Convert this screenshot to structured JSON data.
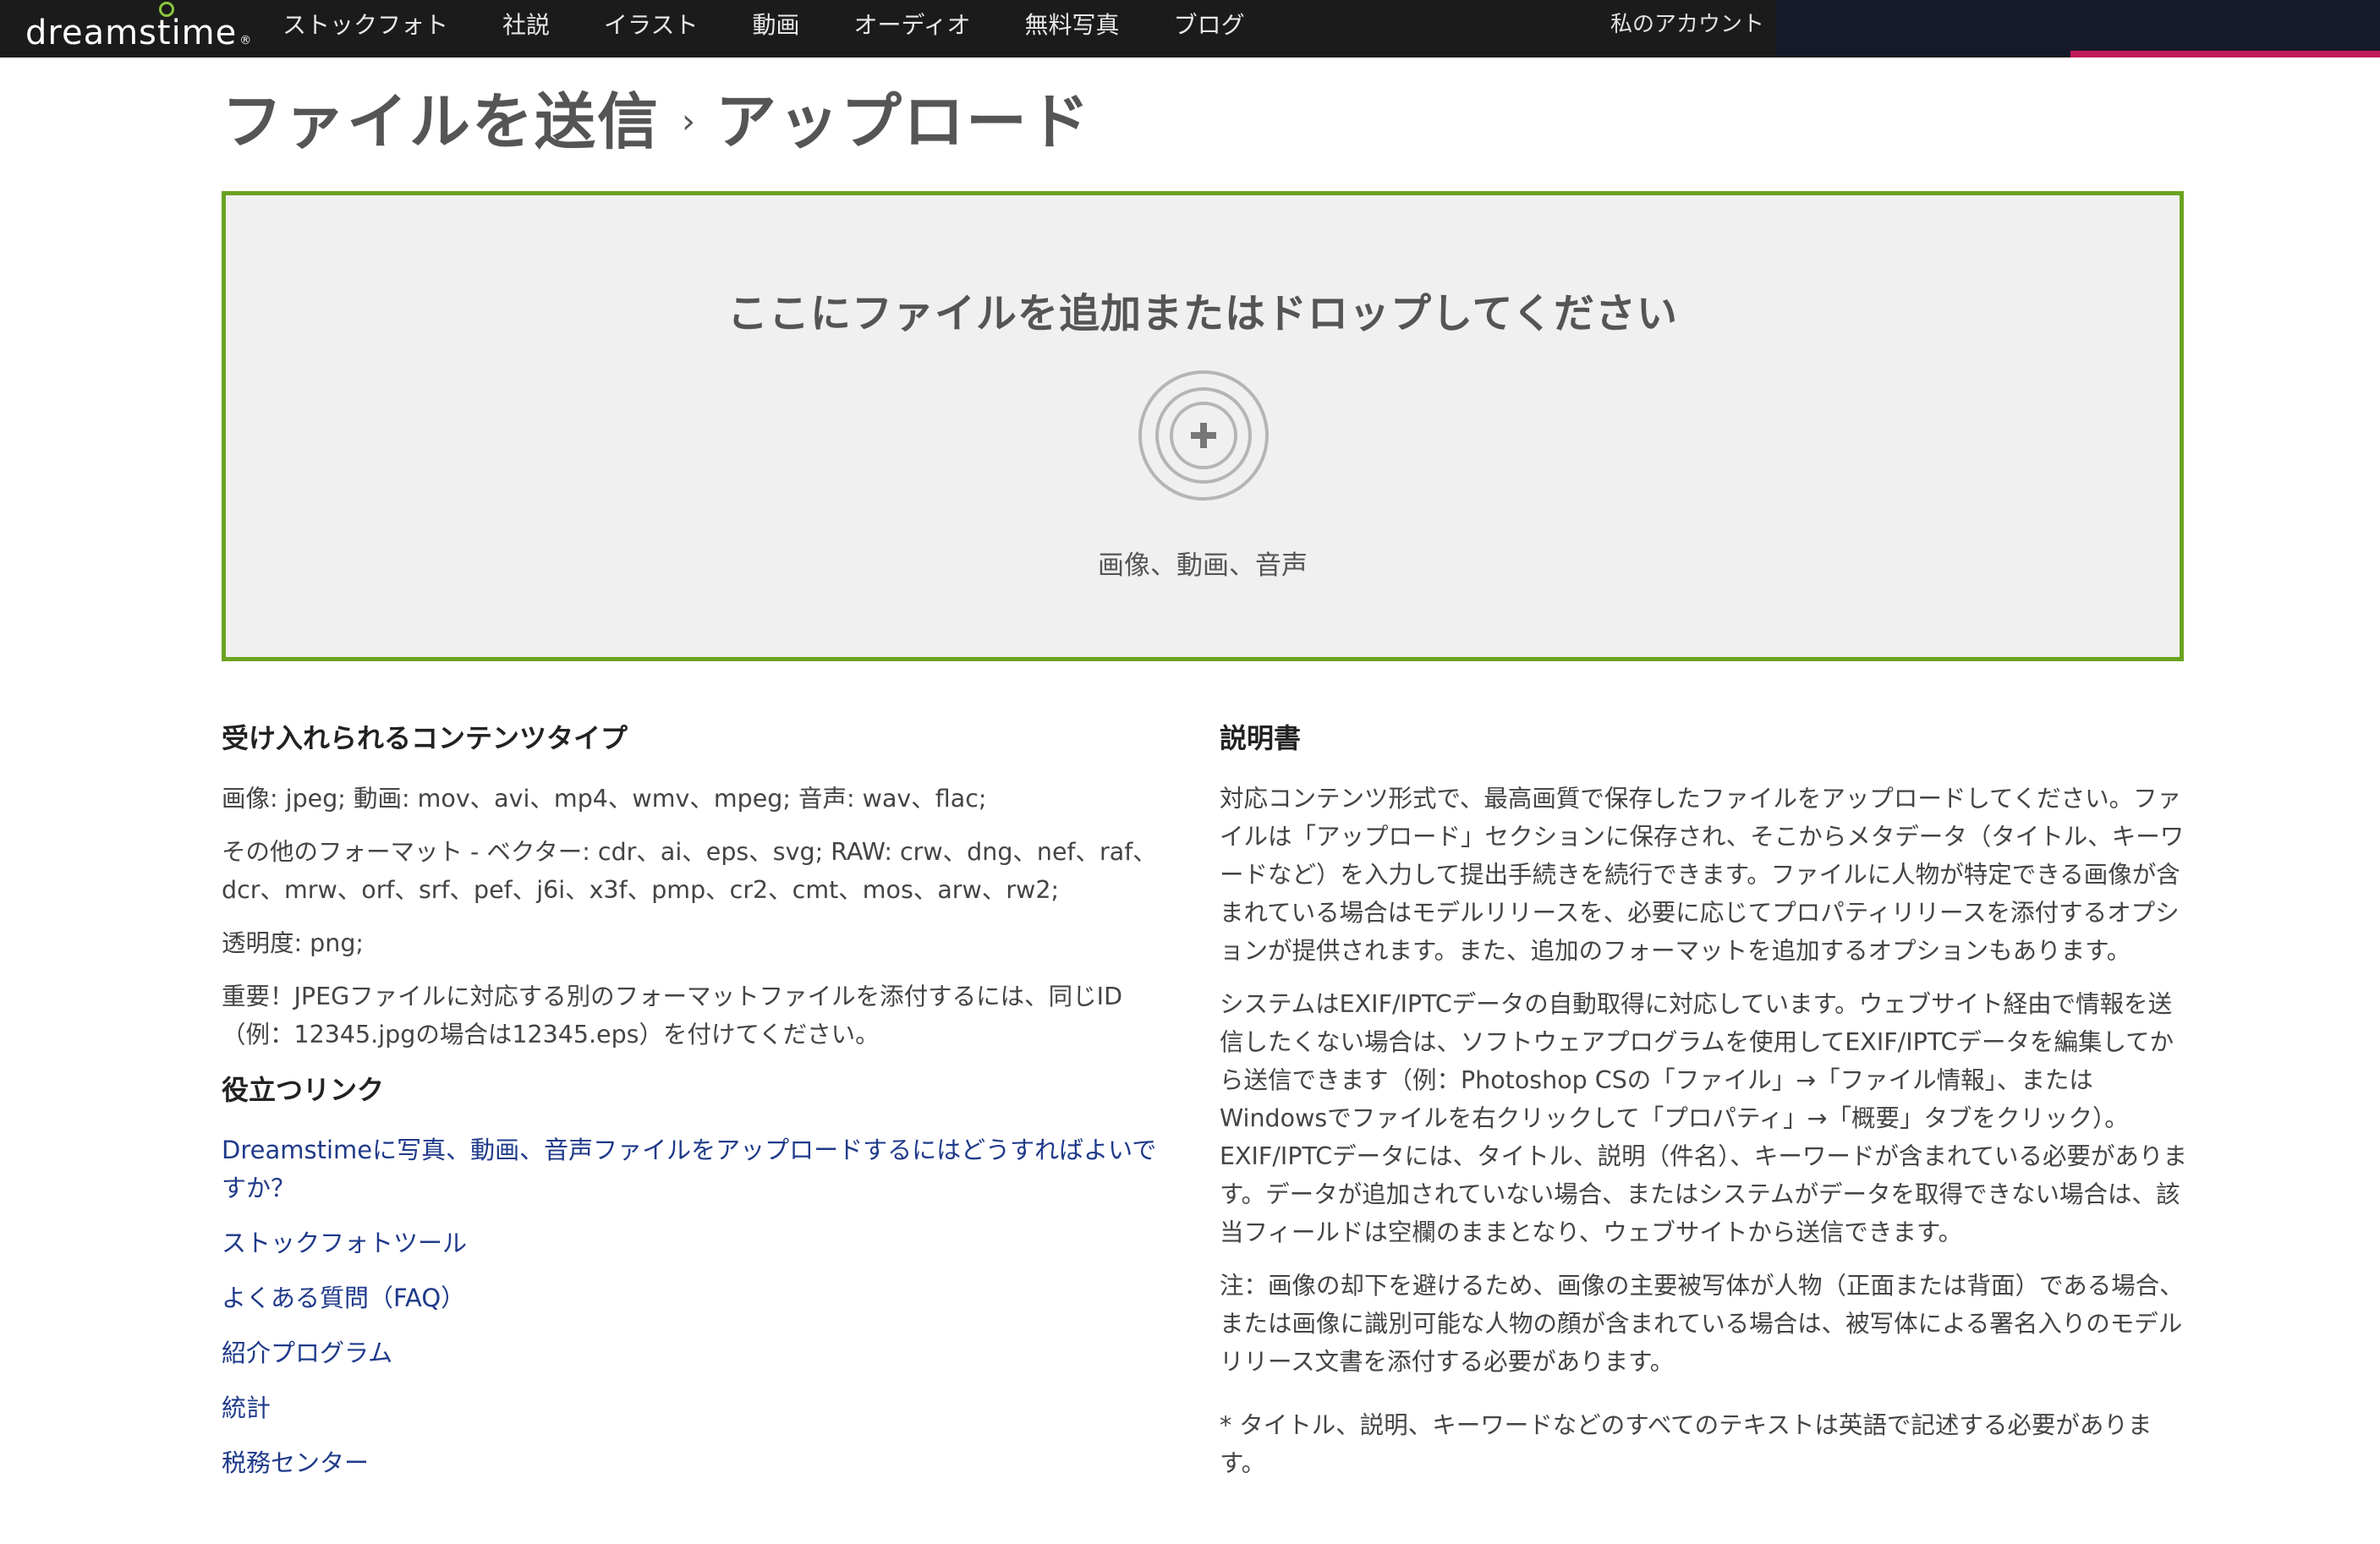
{
  "header": {
    "logo_text": "dreamstime",
    "logo_reg": "®",
    "nav": [
      "ストックフォト",
      "社説",
      "イラスト",
      "動画",
      "オーディオ",
      "無料写真",
      "ブログ"
    ],
    "account": "私のアカウント"
  },
  "breadcrumb": {
    "main": "ファイルを送信",
    "separator": "›",
    "current": "アップロード"
  },
  "dropzone": {
    "title": "ここにファイルを追加またはドロップしてください",
    "subtitle": "画像、動画、音声",
    "icon": "plus-circle-icon"
  },
  "accepted": {
    "title": "受け入れられるコンテンツタイプ",
    "lines": [
      "画像: jpeg; 動画: mov、avi、mp4、wmv、mpeg; 音声: wav、flac;",
      "その他のフォーマット - ベクター: cdr、ai、eps、svg; RAW: crw、dng、nef、raf、dcr、mrw、orf、srf、pef、j6i、x3f、pmp、cr2、cmt、mos、arw、rw2;",
      "透明度: png;",
      "重要！JPEGファイルに対応する別のフォーマットファイルを添付するには、同じID（例：12345.jpgの場合は12345.eps）を付けてください。"
    ]
  },
  "links": {
    "title": "役立つリンク",
    "items": [
      "Dreamstimeに写真、動画、音声ファイルをアップロードするにはどうすればよいですか？",
      "ストックフォトツール",
      "よくある質問（FAQ）",
      "紹介プログラム",
      "統計",
      "税務センター"
    ]
  },
  "instructions": {
    "title": "説明書",
    "paragraphs": [
      "対応コンテンツ形式で、最高画質で保存したファイルをアップロードしてください。ファイルは「アップロード」セクションに保存され、そこからメタデータ（タイトル、キーワードなど）を入力して提出手続きを続行できます。ファイルに人物が特定できる画像が含まれている場合はモデルリリースを、必要に応じてプロパティリリースを添付するオプションが提供されます。また、追加のフォーマットを追加するオプションもあります。",
      "システムはEXIF/IPTCデータの自動取得に対応しています。ウェブサイト経由で情報を送信したくない場合は、ソフトウェアプログラムを使用してEXIF/IPTCデータを編集してから送信できます（例：Photoshop CSの「ファイル」→「ファイル情報」、またはWindowsでファイルを右クリックして「プロパティ」→「概要」タブをクリック）。EXIF/IPTCデータには、タイトル、説明（件名）、キーワードが含まれている必要があります。データが追加されていない場合、またはシステムがデータを取得できない場合は、該当フィールドは空欄のままとなり、ウェブサイトから送信できます。",
      "注：画像の却下を避けるため、画像の主要被写体が人物（正面または背面）である場合、または画像に識別可能な人物の顔が含まれている場合は、被写体による署名入りのモデルリリース文書を添付する必要があります。",
      "* タイトル、説明、キーワードなどのすべてのテキストは英語で記述する必要があります。"
    ]
  },
  "colors": {
    "topbar": "#1b1b1b",
    "dropzone_border": "#6aa320",
    "dropzone_bg": "#f0f0f0",
    "link": "#1f3a8a",
    "accent_pink": "#c2185b"
  }
}
